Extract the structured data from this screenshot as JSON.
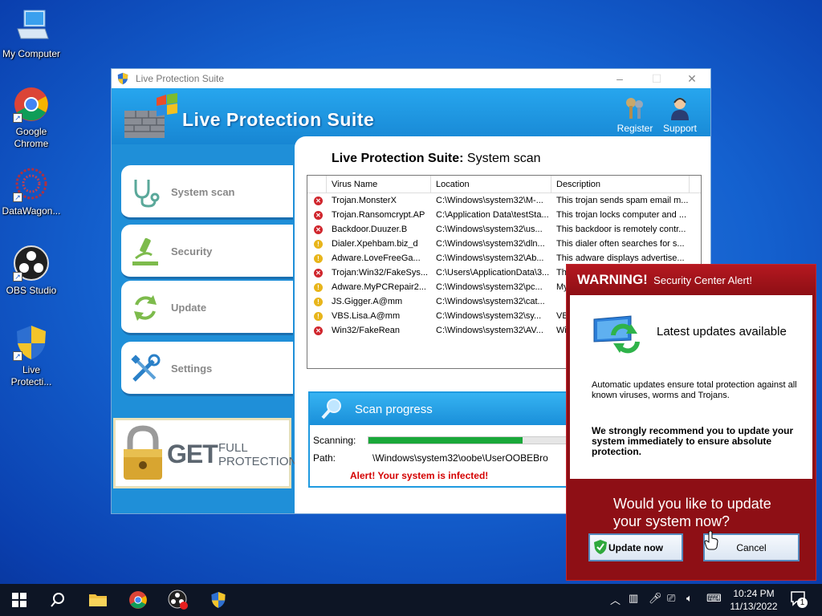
{
  "desktop": {
    "icons": [
      {
        "label": "My Computer"
      },
      {
        "label": "Google Chrome"
      },
      {
        "label": "DataWagon..."
      },
      {
        "label": "OBS Studio"
      },
      {
        "label": "Live Protecti..."
      }
    ]
  },
  "app": {
    "window_title": "Live Protection Suite",
    "title": "Live Protection Suite",
    "header_buttons": {
      "register": "Register",
      "support": "Support"
    },
    "nav": {
      "system_scan": "System scan",
      "security": "Security",
      "update": "Update",
      "settings": "Settings"
    },
    "scan": {
      "title_bold": "Live Protection Suite:",
      "title_rest": " System scan"
    },
    "table": {
      "columns": [
        "Virus Name",
        "Location",
        "Description"
      ],
      "rows": [
        {
          "severity": "high",
          "name": "Trojan.MonsterX",
          "location": "C:\\Windows\\system32\\M-...",
          "desc": "This trojan sends spam email m..."
        },
        {
          "severity": "high",
          "name": "Trojan.Ransomcrypt.AP",
          "location": "C:\\Application Data\\testSta...",
          "desc": "This trojan locks computer and ..."
        },
        {
          "severity": "high",
          "name": "Backdoor.Duuzer.B",
          "location": "C:\\Windows\\system32\\us...",
          "desc": "This backdoor is remotely contr..."
        },
        {
          "severity": "medium",
          "name": "Dialer.Xpehbam.biz_d",
          "location": "C:\\Windows\\system32\\dln...",
          "desc": "This dialer often searches for s..."
        },
        {
          "severity": "medium",
          "name": "Adware.LoveFreeGa...",
          "location": "C:\\Windows\\system32\\Ab...",
          "desc": "This adware displays advertise..."
        },
        {
          "severity": "high",
          "name": "Trojan:Win32/FakeSys...",
          "location": "C:\\Users\\ApplicationData\\3...",
          "desc": "Th"
        },
        {
          "severity": "medium",
          "name": "Adware.MyPCRepair2...",
          "location": "C:\\Windows\\system32\\pc...",
          "desc": "My"
        },
        {
          "severity": "medium",
          "name": "JS.Gigger.A@mm",
          "location": "C:\\Windows\\system32\\cat...",
          "desc": ""
        },
        {
          "severity": "medium",
          "name": "VBS.Lisa.A@mm",
          "location": "C:\\Windows\\system32\\sy...",
          "desc": "VB"
        },
        {
          "severity": "high",
          "name": "Win32/FakeRean",
          "location": "C:\\Windows\\system32\\AV...",
          "desc": "Wi"
        }
      ]
    },
    "progress": {
      "title": "Scan progress",
      "scanning_label": "Scanning:",
      "path_label": "Path:",
      "path_value": "\\Windows\\system32\\oobe\\UserOOBEBro",
      "alert": "Alert! Your system is infected!",
      "fraction": 0.78
    },
    "banner": {
      "get": "GET",
      "full": "FULL",
      "protection": "PROTECTION"
    }
  },
  "alert": {
    "warning": "WARNING!",
    "subtitle": "Security Center Alert!",
    "headline": "Latest updates available",
    "text1": "Automatic updates ensure total protection against all known viruses, worms and Trojans.",
    "text2": "We strongly recommend you to update your system immediately to ensure absolute protection.",
    "question": "Would you like to update your system now?",
    "update_btn": "Update now",
    "cancel_btn": "Cancel"
  },
  "taskbar": {
    "time": "10:24 PM",
    "date": "11/13/2022",
    "notification_count": "1"
  },
  "colors": {
    "desktop": "#1461cf",
    "app_blue": "#1f8fd8",
    "alert_red": "#8e0f15",
    "progress_green": "#1aa83a",
    "alert_text": "#d40000"
  }
}
